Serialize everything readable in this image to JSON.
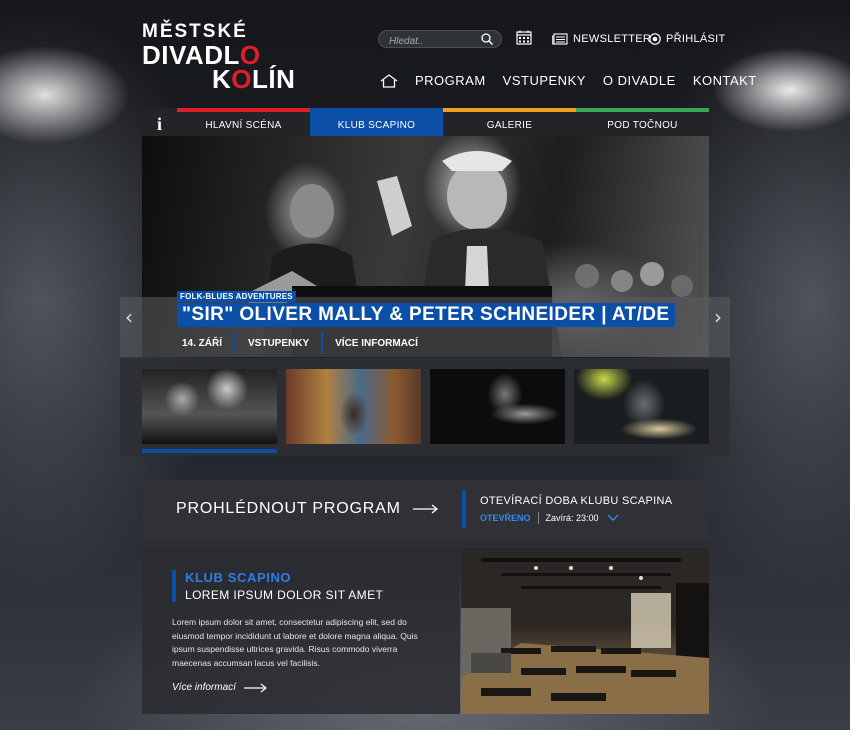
{
  "logo": {
    "line1": "MĚSTSKÉ",
    "line2_a": "DIVADL",
    "line2_b": "O",
    "line3_a": "K",
    "line3_b": "O",
    "line3_c": "LÍN"
  },
  "search": {
    "placeholder": "Hledat.."
  },
  "top_links": {
    "newsletter": "NEWSLETTER",
    "login": "PŘIHLÁSIT"
  },
  "nav": {
    "items": [
      "PROGRAM",
      "VSTUPENKY",
      "O DIVADLE",
      "KONTAKT"
    ]
  },
  "tabs": [
    {
      "label": "HLAVNÍ SCÉNA",
      "color": "#e11d2a"
    },
    {
      "label": "KLUB SCAPINO",
      "color": "#0c4fa8"
    },
    {
      "label": "GALERIE",
      "color": "#f0a01c"
    },
    {
      "label": "POD TOČNOU",
      "color": "#3aa655"
    }
  ],
  "hero": {
    "kicker": "FOLK-BLUES ADVENTURES",
    "title": "\"SIR\" OLIVER MALLY & PETER SCHNEIDER | AT/DE",
    "date": "14. ZÁŘÍ",
    "tickets": "VSTUPENKY",
    "more": "VÍCE INFORMACÍ"
  },
  "program": {
    "label": "PROHLÉDNOUT PROGRAM"
  },
  "hours": {
    "title": "OTEVÍRACÍ DOBA KLUBU SCAPINA",
    "status": "OTEVŘENO",
    "closes": "Zavírá: 23:00"
  },
  "club": {
    "kicker": "KLUB SCAPINO",
    "title": "LOREM IPSUM DOLOR SIT AMET",
    "text": "Lorem ipsum dolor sit amet, consectetur adipiscing elit, sed do eiusmod tempor incididunt ut labore et dolore magna aliqua. Quis ipsum suspendisse ultrices gravida. Risus commodo viverra maecenas accumsan lacus vel facilisis.",
    "more": "Více informací"
  },
  "colors": {
    "accent": "#0c4fa8",
    "red": "#e11d2a",
    "orange": "#f0a01c",
    "green": "#3aa655"
  }
}
